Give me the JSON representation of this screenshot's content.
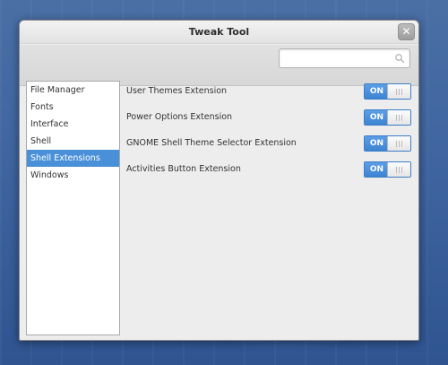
{
  "window": {
    "title": "Tweak Tool",
    "close_glyph": "✕"
  },
  "search": {
    "placeholder": "",
    "value": ""
  },
  "sidebar": {
    "items": [
      {
        "label": "File Manager",
        "selected": false
      },
      {
        "label": "Fonts",
        "selected": false
      },
      {
        "label": "Interface",
        "selected": false
      },
      {
        "label": "Shell",
        "selected": false
      },
      {
        "label": "Shell Extensions",
        "selected": true
      },
      {
        "label": "Windows",
        "selected": false
      }
    ]
  },
  "extensions": [
    {
      "label": "User Themes Extension",
      "state": "ON"
    },
    {
      "label": "Power Options Extension",
      "state": "ON"
    },
    {
      "label": "GNOME Shell Theme Selector Extension",
      "state": "ON"
    },
    {
      "label": "Activities Button Extension",
      "state": "ON"
    }
  ],
  "icons": {
    "search": "search-icon",
    "close": "close-icon"
  },
  "colors": {
    "accent": "#4a90d9",
    "desktop": "#3f64a0"
  }
}
